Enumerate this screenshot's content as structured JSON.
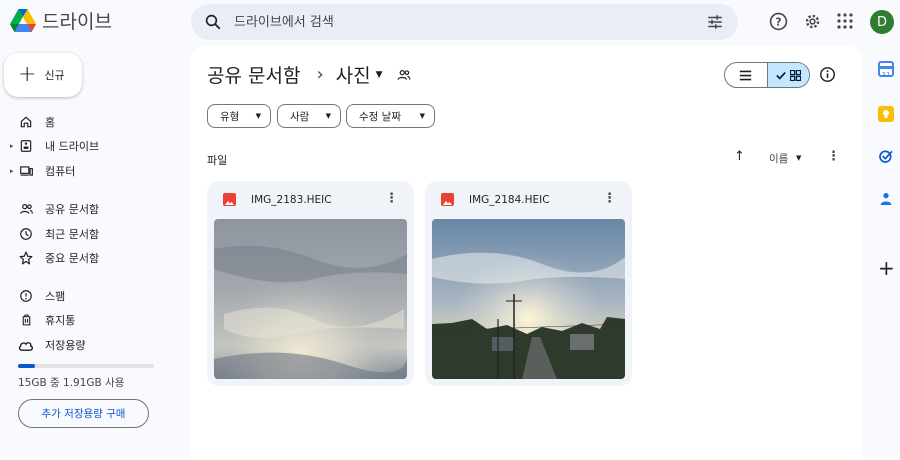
{
  "app": {
    "name": "드라이브"
  },
  "search": {
    "placeholder": "드라이브에서 검색"
  },
  "header": {
    "avatar_letter": "D"
  },
  "new_button": {
    "label": "신규"
  },
  "sidebar": {
    "items": [
      {
        "label": "홈",
        "icon": "home-icon"
      },
      {
        "label": "내 드라이브",
        "icon": "my-drive-icon"
      },
      {
        "label": "컴퓨터",
        "icon": "computer-icon"
      },
      {
        "label": "공유 문서함",
        "icon": "shared-icon"
      },
      {
        "label": "최근 문서함",
        "icon": "clock-icon"
      },
      {
        "label": "중요 문서함",
        "icon": "star-icon"
      },
      {
        "label": "스팸",
        "icon": "spam-icon"
      },
      {
        "label": "휴지통",
        "icon": "trash-icon"
      },
      {
        "label": "저장용량",
        "icon": "cloud-icon"
      }
    ],
    "storage_text": "15GB 중 1.91GB 사용",
    "storage_fraction": 0.127,
    "buy_label": "추가 저장용량 구매"
  },
  "breadcrumb": {
    "parent": "공유 문서함",
    "current": "사진"
  },
  "filters": [
    "유형",
    "사람",
    "수정 날짜"
  ],
  "files_section": {
    "label": "파일",
    "sort_label": "이름"
  },
  "files": [
    {
      "name": "IMG_2183.HEIC"
    },
    {
      "name": "IMG_2184.HEIC"
    }
  ],
  "colors": {
    "accent": "#0b57d0",
    "selected": "#c2e7ff",
    "image_icon": "#ea4335"
  }
}
